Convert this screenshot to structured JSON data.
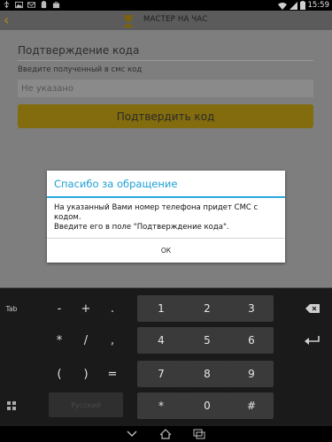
{
  "status_bar": {
    "time": "15:59"
  },
  "app_bar": {
    "title": "МАСТЕР НА ЧАС"
  },
  "form": {
    "section_title": "Подтверждение кода",
    "code_label": "Введите полученный в смс код",
    "code_placeholder": "Не указано",
    "confirm_label": "Подтвердить код"
  },
  "dialog": {
    "title": "Спасибо за обращение",
    "message_lines": [
      "На указанный Вами номер телефона придет СМС с",
      "кодом.",
      "Введите его в поле \"Подтверждение кода\"."
    ],
    "ok_label": "ОК"
  },
  "keyboard": {
    "tab_label": "Tab",
    "space_label": "Русский",
    "symbol_keys": [
      "-",
      "+",
      ".",
      "*",
      "/",
      ",",
      "(",
      ")",
      "="
    ],
    "digit_keys": [
      "1",
      "2",
      "3",
      "4",
      "5",
      "6",
      "7",
      "8",
      "9",
      "*",
      "0",
      "#"
    ]
  },
  "colors": {
    "accent_blue": "#2aa7dc",
    "brand_yellow": "#f6c219",
    "dim_overlay": "#7e7e7e"
  },
  "icons": {
    "status_left": [
      "usb-icon",
      "image-icon",
      "mail-icon",
      "android-icon",
      "market-icon"
    ],
    "status_right": [
      "wifi-icon",
      "signal-icon",
      "battery-icon"
    ],
    "nav": [
      "back-icon",
      "home-icon",
      "recents-icon"
    ]
  }
}
